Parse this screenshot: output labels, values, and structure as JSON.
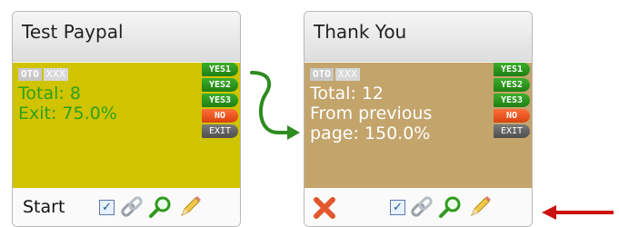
{
  "cards": [
    {
      "title": "Test Paypal",
      "tags": [
        "OTO",
        "XXX"
      ],
      "stats": [
        "Total: 8",
        "Exit: 75.0%"
      ],
      "buttons": [
        "YES1",
        "YES2",
        "YES3",
        "NO",
        "EXIT"
      ],
      "footer_label": "Start",
      "checkbox_checked": true
    },
    {
      "title": "Thank You",
      "tags": [
        "OTO",
        "XXX"
      ],
      "stats": [
        "Total: 12",
        "From previous",
        "page: 150.0%"
      ],
      "buttons": [
        "YES1",
        "YES2",
        "YES3",
        "NO",
        "EXIT"
      ],
      "footer_label": "",
      "checkbox_checked": true
    }
  ],
  "icons": {
    "delete": "close-icon",
    "link": "link-icon",
    "search": "search-icon",
    "edit": "pencil-icon"
  },
  "colors": {
    "card1_body": "#d0c300",
    "card2_body": "#c3a46b",
    "connector": "#2e8b1f",
    "annotation_arrow": "#cc1111",
    "yes": "#2e9a1c",
    "no": "#e0521b",
    "exit": "#5a5a5a"
  }
}
